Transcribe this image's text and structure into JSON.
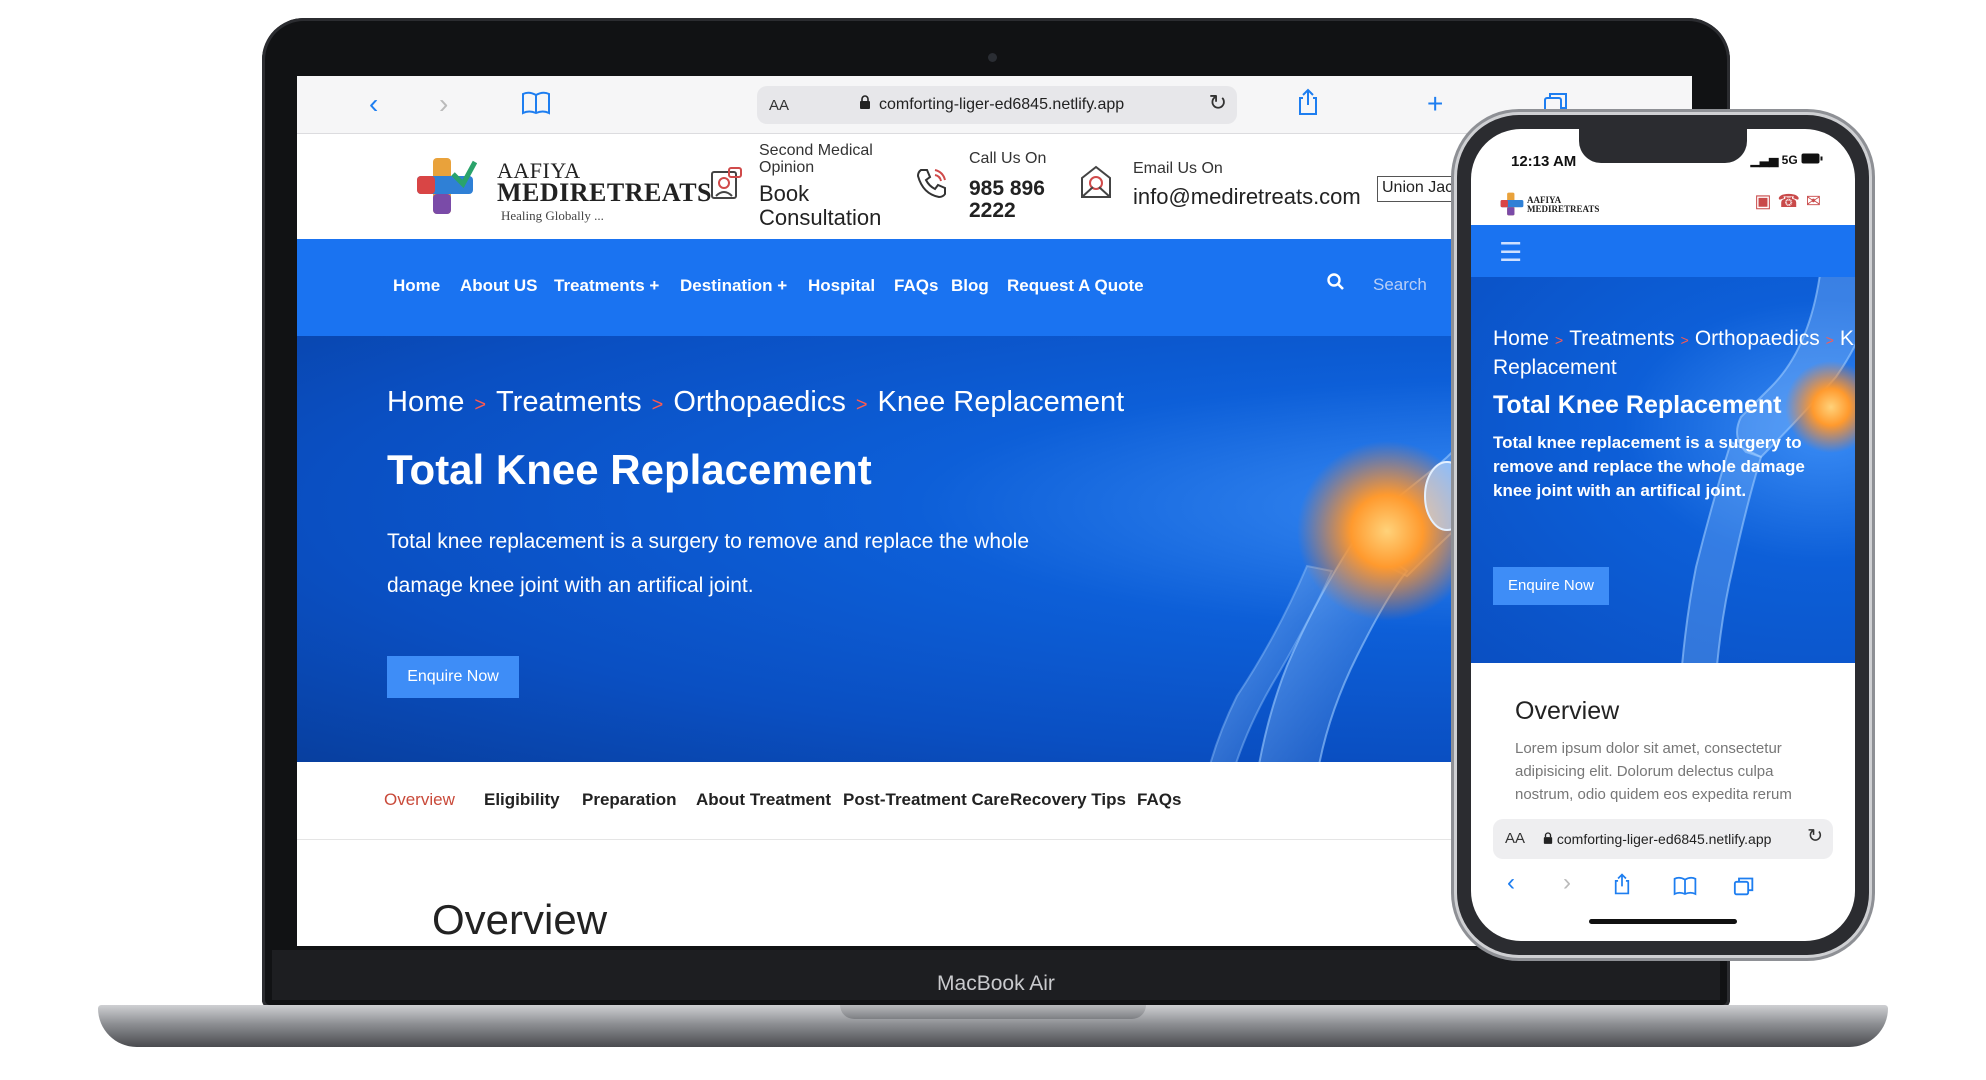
{
  "device": {
    "laptop_label": "MacBook Air"
  },
  "browser": {
    "aa": "AA",
    "url": "comforting-liger-ed6845.netlify.app",
    "icons": [
      "back-icon",
      "forward-icon",
      "bookmarks-icon",
      "share-icon",
      "new-tab-icon",
      "tabs-icon",
      "reload-icon",
      "lock-icon"
    ]
  },
  "header": {
    "logo_line1": "AAFIYA",
    "logo_line2": "MEDIRETREATS",
    "logo_tagline": "Healing Globally ...",
    "consult_small": "Second Medical Opinion",
    "consult_big": "Book Consultation",
    "call_small": "Call Us On",
    "call_big": "985 896 2222",
    "email_small": "Email Us On",
    "email_big": "info@mediretreats.com",
    "language": "Union Jack"
  },
  "nav": {
    "items": [
      "Home",
      "About US",
      "Treatments +",
      "Destination +",
      "Hospital",
      "FAQs",
      "Blog",
      "Request A Quote"
    ],
    "search_placeholder": "Search"
  },
  "hero": {
    "breadcrumb": [
      "Home",
      "Treatments",
      "Orthopaedics",
      "Knee Replacement"
    ],
    "separator": ">",
    "title": "Total Knee Replacement",
    "description": "Total knee replacement is a surgery to remove and replace the whole damage knee joint with an artifical joint.",
    "button": "Enquire Now"
  },
  "tabs": [
    "Overview",
    "Eligibility",
    "Preparation",
    "About Treatment",
    "Post-Treatment Care",
    "Recovery Tips",
    "FAQs"
  ],
  "overview_heading": "Overview",
  "phone": {
    "time": "12:13 AM",
    "status": "5G",
    "logo_line1": "AAFIYA",
    "logo_line2": "MEDIRETREATS",
    "breadcrumb": [
      "Home",
      "Treatments",
      "Orthopaedics",
      "Knee Replacement"
    ],
    "title": "Total Knee Replacement",
    "description": "Total knee replacement is a surgery to remove and replace the whole damage knee joint with an artifical joint.",
    "button": "Enquire Now",
    "overview_heading": "Overview",
    "lorem": "Lorem ipsum dolor sit amet, consectetur adipisicing elit. Dolorum delectus culpa nostrum, odio quidem eos expedita rerum maiores ipsa laboriosam. Quasi animi",
    "aa": "AA",
    "url": "comforting-liger-ed6845.netlify.app"
  },
  "colors": {
    "brand_blue": "#1a73f1",
    "accent_red": "#c94a3a",
    "button_blue": "#3e8df7"
  }
}
